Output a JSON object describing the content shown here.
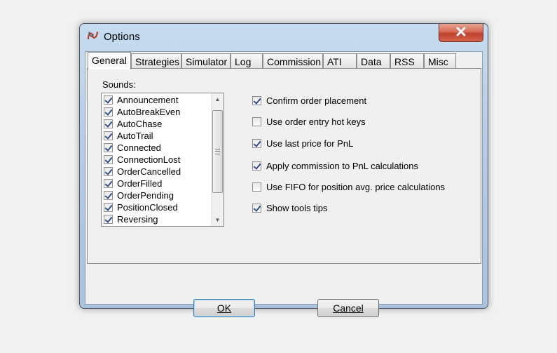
{
  "window": {
    "title": "Options",
    "close_icon": "close-x-icon",
    "app_icon": "ninjatrader-logo-icon"
  },
  "tabs": [
    {
      "label": "General",
      "active": true
    },
    {
      "label": "Strategies",
      "active": false
    },
    {
      "label": "Simulator",
      "active": false
    },
    {
      "label": "Log",
      "active": false
    },
    {
      "label": "Commission",
      "active": false
    },
    {
      "label": "ATI",
      "active": false
    },
    {
      "label": "Data",
      "active": false
    },
    {
      "label": "RSS",
      "active": false
    },
    {
      "label": "Misc",
      "active": false
    }
  ],
  "general": {
    "sounds_label": "Sounds:",
    "sounds": [
      {
        "label": "Announcement",
        "checked": true
      },
      {
        "label": "AutoBreakEven",
        "checked": true
      },
      {
        "label": "AutoChase",
        "checked": true
      },
      {
        "label": "AutoTrail",
        "checked": true
      },
      {
        "label": "Connected",
        "checked": true
      },
      {
        "label": "ConnectionLost",
        "checked": true
      },
      {
        "label": "OrderCancelled",
        "checked": true
      },
      {
        "label": "OrderFilled",
        "checked": true
      },
      {
        "label": "OrderPending",
        "checked": true
      },
      {
        "label": "PositionClosed",
        "checked": true
      },
      {
        "label": "Reversing",
        "checked": true
      }
    ],
    "options": [
      {
        "label": "Confirm order placement",
        "checked": true
      },
      {
        "label": "Use order entry hot keys",
        "checked": false
      },
      {
        "label": "Use last price for PnL",
        "checked": true
      },
      {
        "label": "Apply commission to PnL calculations",
        "checked": true
      },
      {
        "label": "Use FIFO for position avg. price calculations",
        "checked": false
      },
      {
        "label": "Show tools tips",
        "checked": true
      }
    ]
  },
  "buttons": {
    "ok_label": "OK",
    "cancel_label": "Cancel"
  },
  "colors": {
    "title_gradient_top": "#c6dcf0",
    "close_button": "#c0422c",
    "check_mark": "#2d4f8a"
  }
}
